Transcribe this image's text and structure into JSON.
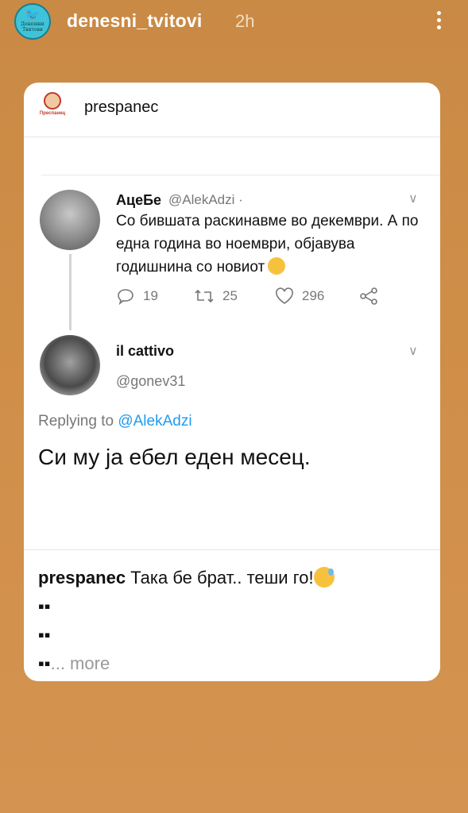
{
  "story": {
    "avatar_text": "Денешни Твитови",
    "username": "denesni_tvitovi",
    "time": "2h"
  },
  "post": {
    "username": "prespanec",
    "avatar_text": "Преспанец"
  },
  "tweet1": {
    "name": "АцеБе",
    "handle": "@AlekAdzi ·",
    "text": "Со бившата раскинавме во декември. А по една година во ноември, објавува годишнина со новиот",
    "replies": "19",
    "retweets": "25",
    "likes": "296"
  },
  "tweet2": {
    "name": "il cattivo",
    "handle": "@gonev31",
    "replying_prefix": "Replying to",
    "replying_to": "@AlekAdzi",
    "text": "Си му ја ебел еден месец."
  },
  "caption": {
    "username": "prespanec",
    "text": "Така бе брат.. теши го!",
    "line2": "▪▪",
    "line3": "▪▪",
    "line4": "▪▪",
    "more": "... more"
  },
  "colors": {
    "background": "#cf8e48",
    "mention": "#1d9bf0"
  }
}
